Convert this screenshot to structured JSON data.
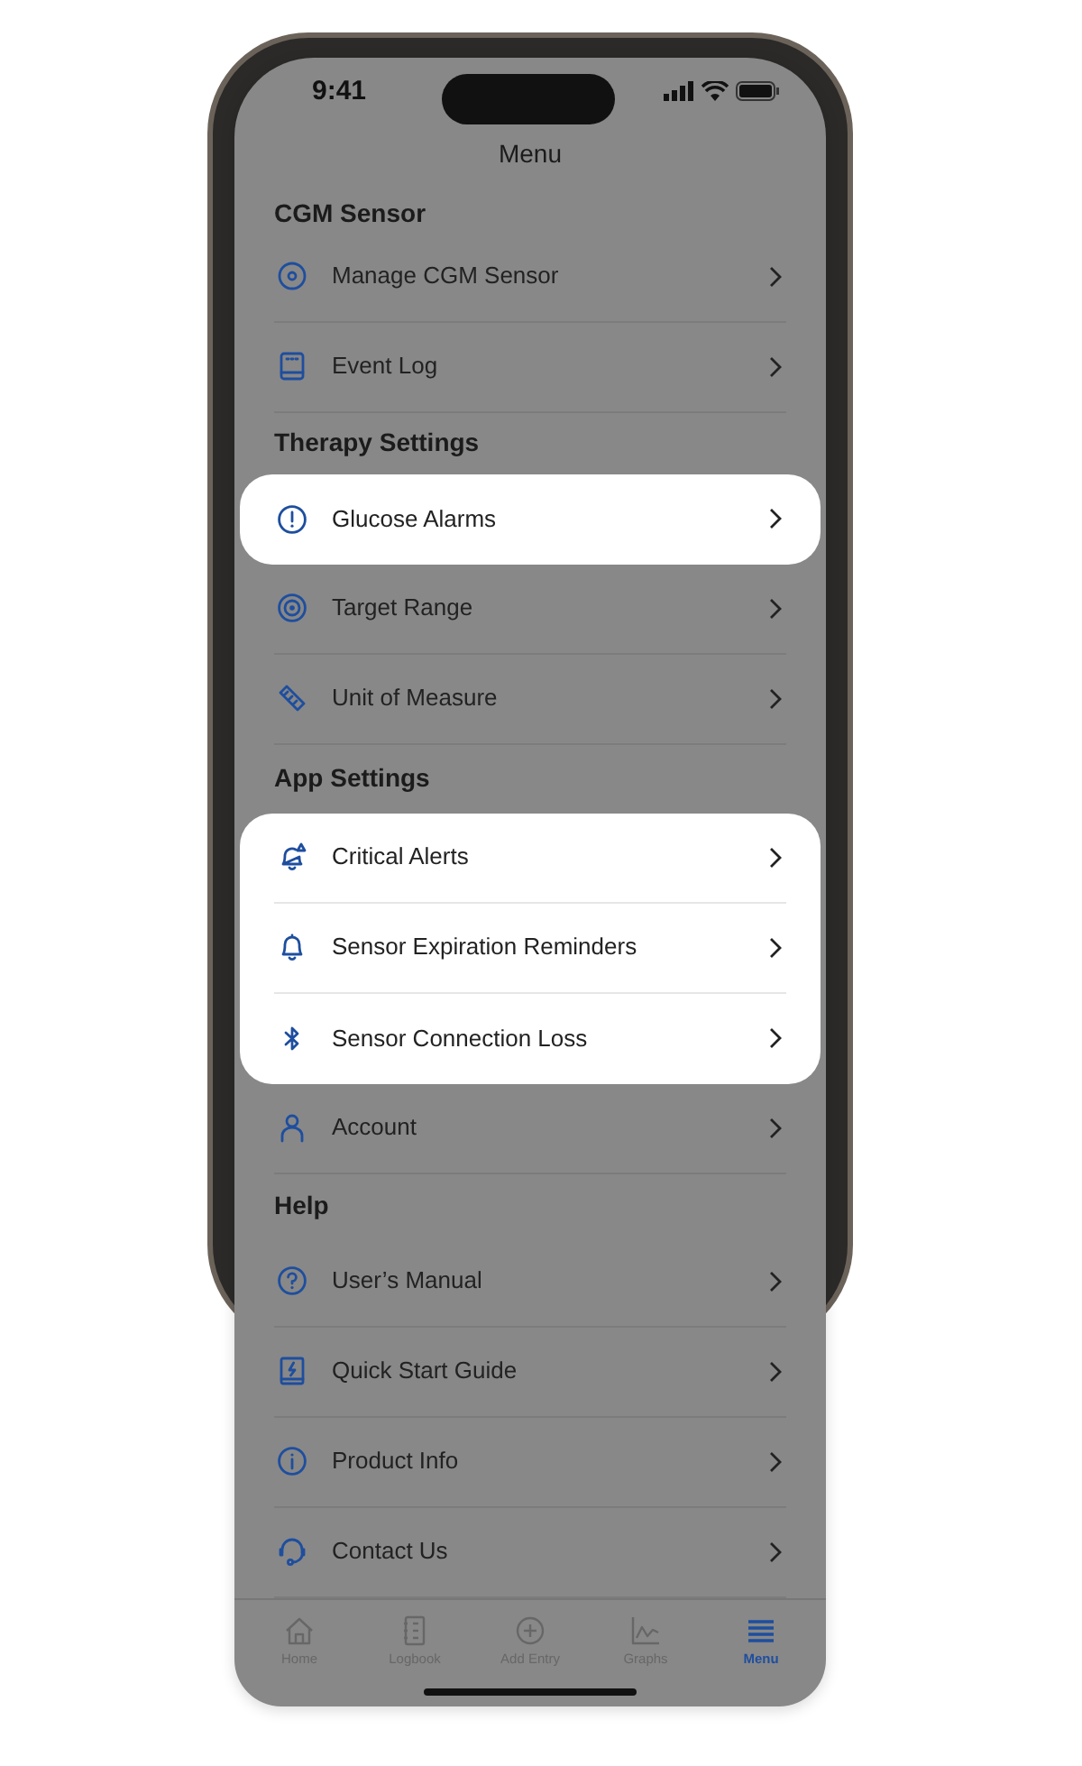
{
  "status_bar": {
    "time": "9:41"
  },
  "title": "Menu",
  "sections": [
    {
      "title": "CGM Sensor",
      "items": [
        {
          "label": "Manage CGM Sensor",
          "highlighted": false
        },
        {
          "label": "Event Log",
          "highlighted": false
        }
      ]
    },
    {
      "title": "Therapy Settings",
      "items": [
        {
          "label": "Glucose Alarms",
          "highlighted": true
        },
        {
          "label": "Target Range",
          "highlighted": false
        },
        {
          "label": "Unit of Measure",
          "highlighted": false
        }
      ]
    },
    {
      "title": "App Settings",
      "items": [
        {
          "label": "Critical Alerts",
          "highlighted": true
        },
        {
          "label": "Sensor Expiration Reminders",
          "highlighted": true
        },
        {
          "label": "Sensor Connection Loss",
          "highlighted": true
        },
        {
          "label": "Account",
          "highlighted": false
        }
      ]
    },
    {
      "title": "Help",
      "items": [
        {
          "label": "User’s Manual",
          "highlighted": false
        },
        {
          "label": "Quick Start Guide",
          "highlighted": false
        },
        {
          "label": "Product Info",
          "highlighted": false
        },
        {
          "label": "Contact Us",
          "highlighted": false
        }
      ]
    }
  ],
  "tab_bar": [
    {
      "label": "Home",
      "selected": false
    },
    {
      "label": "Logbook",
      "selected": false
    },
    {
      "label": "Add Entry",
      "selected": false
    },
    {
      "label": "Graphs",
      "selected": false
    },
    {
      "label": "Menu",
      "selected": true
    }
  ]
}
